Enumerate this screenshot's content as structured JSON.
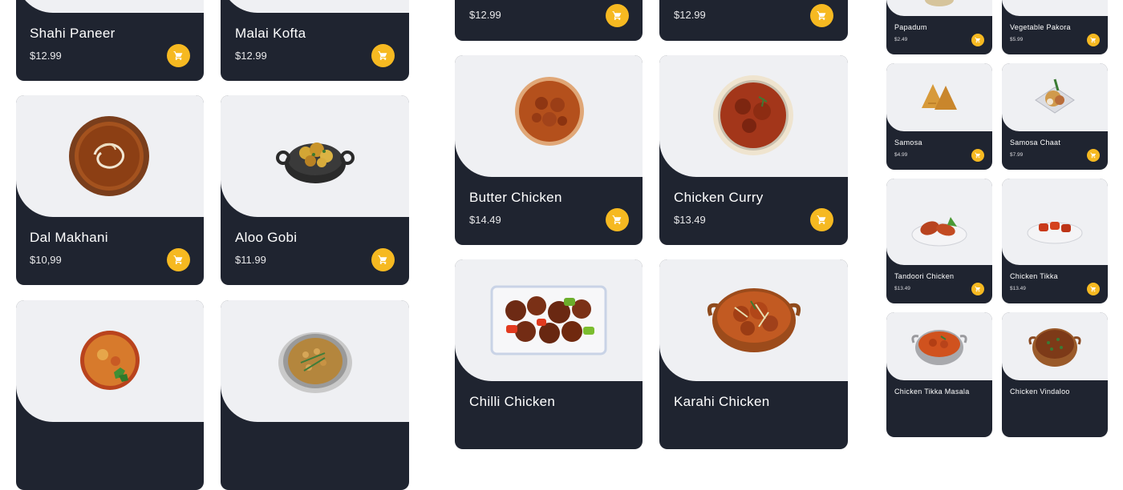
{
  "colors": {
    "card_dark": "#1f2430",
    "image_bg": "#eff0f3",
    "cart_button": "#f6b921",
    "text": "#ffffff"
  },
  "col1": {
    "items": [
      {
        "name": "Shahi Paneer",
        "price": "$12.99",
        "icon": "shahi-paneer"
      },
      {
        "name": "Malai Kofta",
        "price": "$12.99",
        "icon": "malai-kofta"
      },
      {
        "name": "Dal Makhani",
        "price": "$10,99",
        "icon": "dal-makhani"
      },
      {
        "name": "Aloo Gobi",
        "price": "$11.99",
        "icon": "aloo-gobi"
      },
      {
        "name": "",
        "price": "",
        "icon": "vegetable-curry"
      },
      {
        "name": "",
        "price": "",
        "icon": "chana-masala"
      }
    ]
  },
  "col2": {
    "items": [
      {
        "name": "",
        "price": "$12.99",
        "icon": "unknown-dish"
      },
      {
        "name": "",
        "price": "$12.99",
        "icon": "unknown-dish"
      },
      {
        "name": "Butter Chicken",
        "price": "$14.49",
        "icon": "butter-chicken"
      },
      {
        "name": "Chicken Curry",
        "price": "$13.49",
        "icon": "chicken-curry"
      },
      {
        "name": "Chilli Chicken",
        "price": "",
        "icon": "chilli-chicken"
      },
      {
        "name": "Karahi Chicken",
        "price": "",
        "icon": "karahi-chicken"
      }
    ]
  },
  "col3": {
    "items": [
      {
        "name": "Papadum",
        "price": "$2.49",
        "icon": "papadum"
      },
      {
        "name": "Vegetable Pakora",
        "price": "$5.99",
        "icon": "vegetable-pakora"
      },
      {
        "name": "Samosa",
        "price": "$4.99",
        "icon": "samosa"
      },
      {
        "name": "Samosa Chaat",
        "price": "$7.99",
        "icon": "samosa-chaat"
      },
      {
        "name": "Tandoori Chicken",
        "price": "$13.49",
        "icon": "tandoori-chicken"
      },
      {
        "name": "Chicken Tikka",
        "price": "$13.49",
        "icon": "chicken-tikka"
      },
      {
        "name": "Chicken Tikka Masala",
        "price": "",
        "icon": "chicken-tikka-masala"
      },
      {
        "name": "Chicken Vindaloo",
        "price": "",
        "icon": "chicken-vindaloo"
      }
    ]
  },
  "cart_icon": "cart-icon"
}
